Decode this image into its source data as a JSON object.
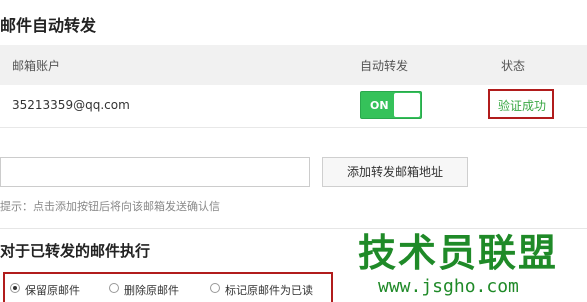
{
  "section": {
    "title": "邮件自动转发"
  },
  "table": {
    "headers": {
      "account": "邮箱账户",
      "forward": "自动转发",
      "status": "状态"
    },
    "rows": [
      {
        "email": "35213359@qq.com",
        "toggle": "ON",
        "status": "验证成功"
      }
    ]
  },
  "add": {
    "input_value": "",
    "button_label": "添加转发邮箱地址",
    "hint": "提示：点击添加按钮后将向该邮箱发送确认信"
  },
  "after": {
    "title": "对于已转发的邮件执行",
    "options": [
      {
        "label": "保留原邮件",
        "checked": true
      },
      {
        "label": "删除原邮件",
        "checked": false
      },
      {
        "label": "标记原邮件为已读",
        "checked": false
      }
    ]
  },
  "watermark": {
    "title": "技术员联盟",
    "url": "www.jsgho.com"
  },
  "colors": {
    "toggle_on": "#35c25a",
    "success": "#3aa845",
    "highlight_border": "#b11c1c",
    "watermark": "#1f8a28"
  }
}
